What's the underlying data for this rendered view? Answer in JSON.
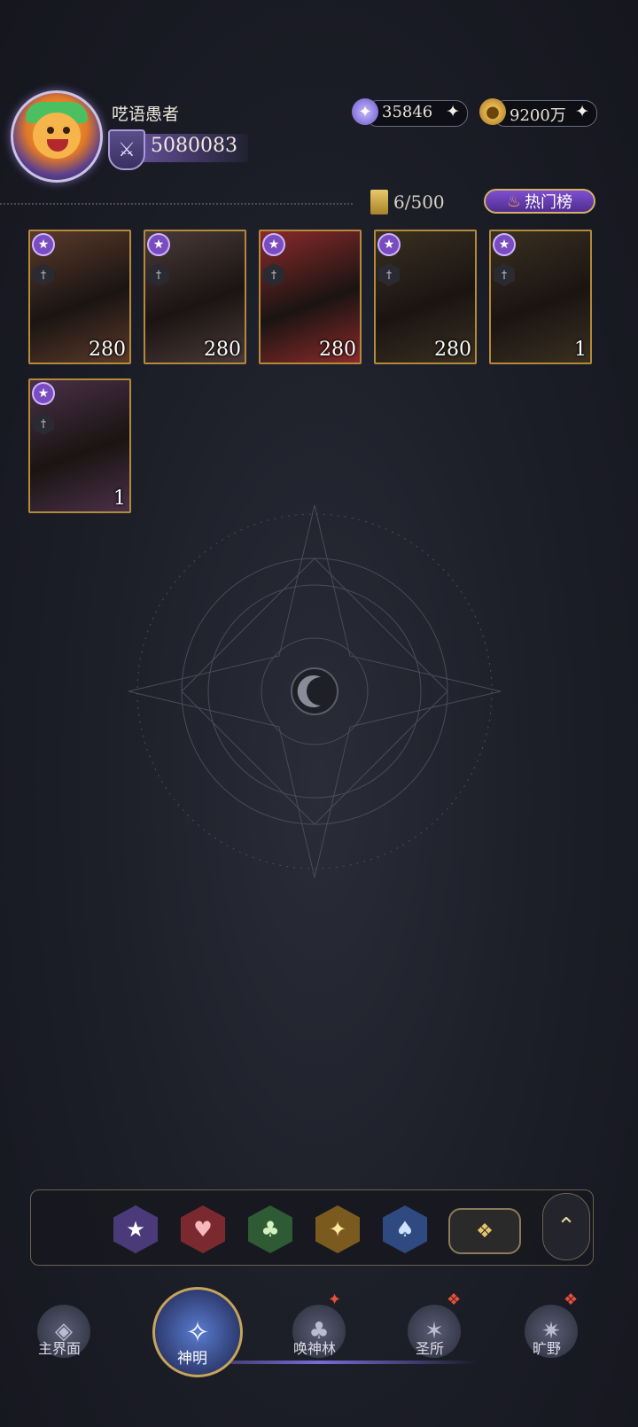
{
  "header": {
    "username": "呓语愚者",
    "power_value": "5080083",
    "resources": [
      {
        "icon": "star-crystal-icon",
        "value": "35846"
      },
      {
        "icon": "gold-coin-icon",
        "value": "9200万"
      }
    ],
    "card_count": "6/500",
    "hot_button_label": "热门榜"
  },
  "cards": [
    {
      "level": "280",
      "rarity_icon": "star-badge-icon",
      "class_icon": "wing-class-icon",
      "bg": "#5a3a2a"
    },
    {
      "level": "280",
      "rarity_icon": "star-badge-icon",
      "class_icon": "gear-class-icon",
      "bg": "#4a3a3a"
    },
    {
      "level": "280",
      "rarity_icon": "star-badge-icon",
      "class_icon": "shield-class-icon",
      "bg": "#8a2a2a"
    },
    {
      "level": "280",
      "rarity_icon": "star-badge-icon",
      "class_icon": "sword-class-icon",
      "bg": "#3a3020"
    },
    {
      "level": "1",
      "rarity_icon": "star-badge-icon",
      "class_icon": "sword-class-icon",
      "bg": "#3a3020"
    },
    {
      "level": "1",
      "rarity_icon": "star-badge-icon",
      "class_icon": "sword-class-icon",
      "bg": "#4a3048"
    }
  ],
  "suit_filters": [
    "star-suit-icon",
    "heart-suit-icon",
    "club-suit-icon",
    "diamond-suit-icon",
    "spade-suit-icon",
    "all-suits-icon"
  ],
  "nav": {
    "items": [
      {
        "label": "主界面",
        "icon": "home-icon"
      },
      {
        "label": "神明",
        "icon": "book-icon"
      },
      {
        "label": "唤神林",
        "icon": "tree-icon"
      },
      {
        "label": "圣所",
        "icon": "sanctum-icon"
      },
      {
        "label": "旷野",
        "icon": "compass-icon"
      }
    ]
  }
}
